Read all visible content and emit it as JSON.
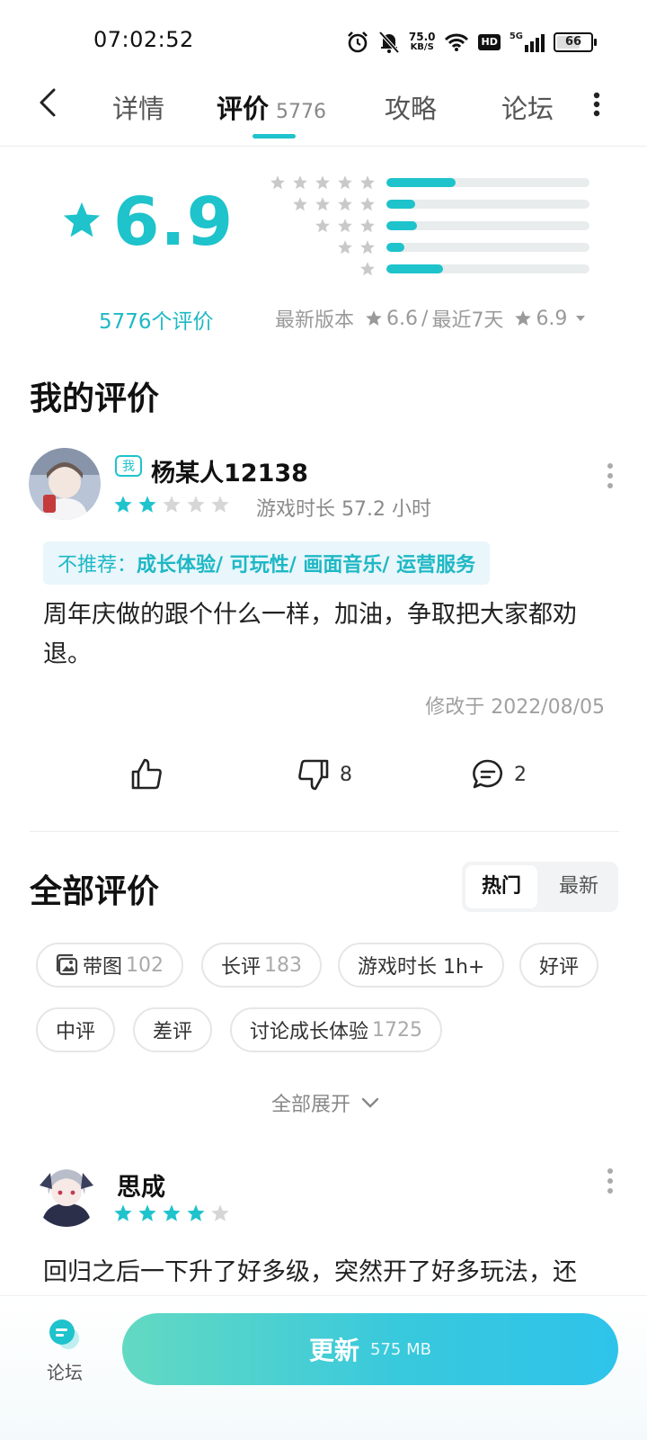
{
  "status_bar": {
    "time": "07:02:52",
    "net_speed_value": "75.0",
    "net_speed_unit": "KB/S",
    "hd_label": "HD",
    "signal_label": "5G",
    "battery": "66"
  },
  "tabs": {
    "details": "详情",
    "reviews": "评价",
    "reviews_count": "5776",
    "guides": "攻略",
    "forum": "论坛"
  },
  "rating": {
    "score": "6.9",
    "review_count_label": "5776个评价",
    "distribution_fraction": {
      "five": 0.34,
      "four": 0.14,
      "three": 0.15,
      "two": 0.09,
      "one": 0.28
    },
    "latest_version_label": "最新版本",
    "latest_version_score": "6.6",
    "separator": "/",
    "recent_label": "最近7天",
    "recent_score": "6.9"
  },
  "my_review": {
    "section_title": "我的评价",
    "me_badge": "我",
    "username": "杨某人12138",
    "stars": 2,
    "playtime": "游戏时长 57.2 小时",
    "tag_label": "不推荐：",
    "tag_values": "成长体验/ 可玩性/ 画面音乐/ 运营服务",
    "text": "周年庆做的跟个什么一样，加油，争取把大家都劝退。",
    "modified": "修改于 2022/08/05",
    "dislike_count": "8",
    "comment_count": "2"
  },
  "all_reviews": {
    "section_title": "全部评价",
    "sort_hot": "热门",
    "sort_new": "最新",
    "filters": [
      {
        "label": "带图",
        "count": "102"
      },
      {
        "label": "长评",
        "count": "183"
      },
      {
        "label": "游戏时长 1h+",
        "count": ""
      },
      {
        "label": "好评",
        "count": ""
      },
      {
        "label": "中评",
        "count": ""
      },
      {
        "label": "差评",
        "count": ""
      },
      {
        "label": "讨论成长体验",
        "count": "1725"
      }
    ],
    "expand_label": "全部展开"
  },
  "review2": {
    "username": "思成",
    "stars": 4,
    "text": "回归之后一下升了好多级，突然开了好多玩法，还"
  },
  "bottom": {
    "forum_label": "论坛",
    "update_label": "更新",
    "update_size": "575 MB"
  },
  "colors": {
    "accent": "#1ec3cb",
    "star_inactive": "#d6d6d6",
    "tag_bg": "#e9f6fb"
  }
}
